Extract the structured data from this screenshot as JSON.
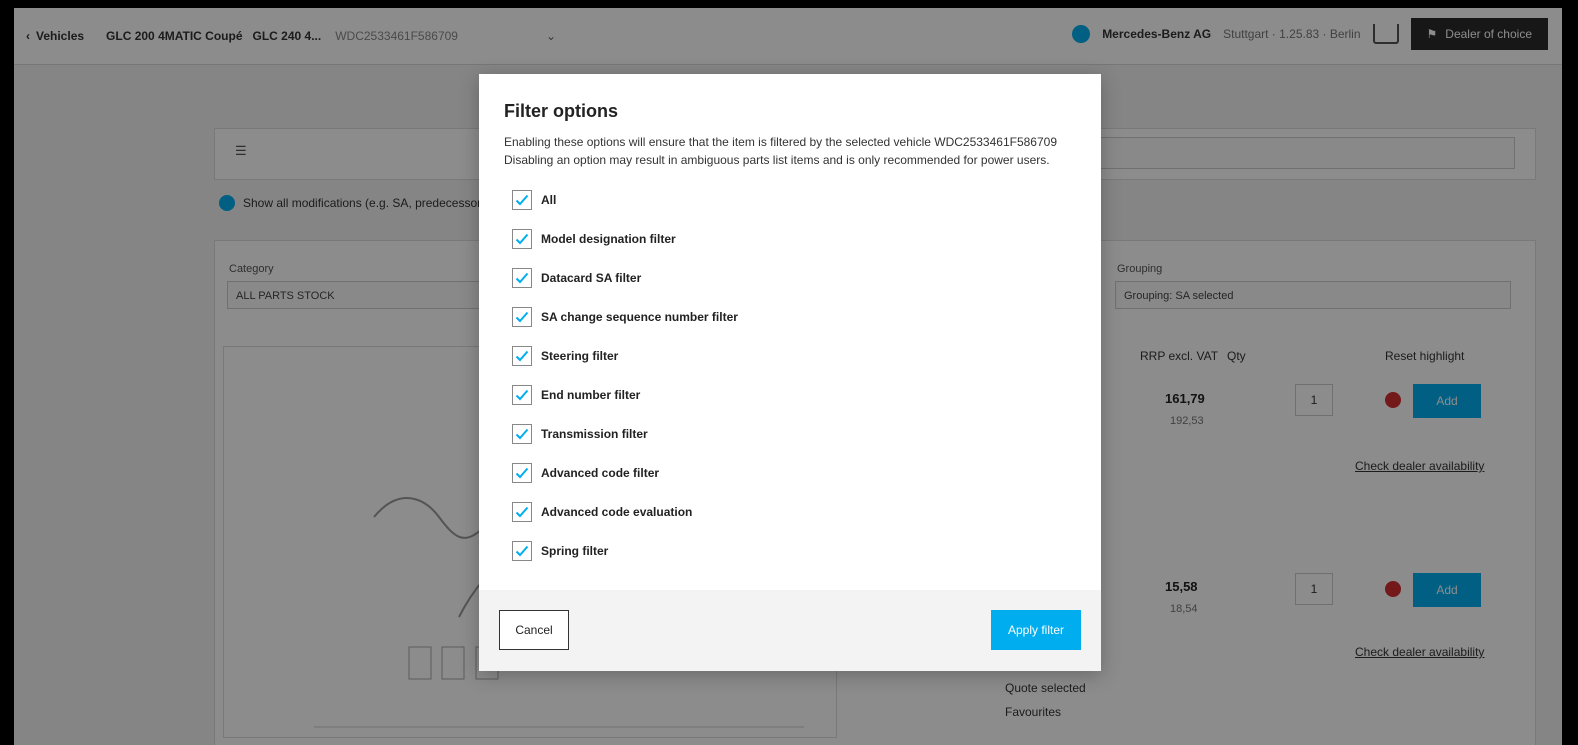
{
  "background": {
    "nav": {
      "back_label": "Vehicles",
      "vehicle_model": "GLC 200 4MATIC Coupé",
      "vehicle_engine": "GLC 240 4...",
      "vin": "WDC2533461F586709",
      "company": "Mercedes-Benz AG",
      "branch": "Stuttgart · 1.25.83 · Berlin",
      "dealer_button": "Dealer of choice"
    },
    "info_text": "Show all modifications (e.g. SA, predecessors, successors)",
    "category_label": "Category",
    "category_value": "ALL PARTS STOCK",
    "grouping_label": "Grouping",
    "grouping_value": "Grouping: SA selected",
    "col_price": "RRP excl. VAT",
    "col_qty": "Qty",
    "col_highlight": "Reset highlight",
    "rows": [
      {
        "price": "161,79",
        "subprice": "192,53",
        "qty": "1",
        "button": "Add",
        "link": "Check dealer availability"
      },
      {
        "price": "15,58",
        "subprice": "18,54",
        "qty": "1",
        "button": "Add",
        "link": "Check dealer availability"
      }
    ],
    "side_links": [
      "Quote selected",
      "Favourites"
    ]
  },
  "modal": {
    "title": "Filter options",
    "description_line1": "Enabling these options will ensure that the item is filtered by the selected vehicle WDC2533461F586709",
    "description_line2": "Disabling an option may result in ambiguous parts list items and is only recommended for power users.",
    "options": [
      {
        "label": "All",
        "checked": true
      },
      {
        "label": "Model designation filter",
        "checked": true
      },
      {
        "label": "Datacard SA filter",
        "checked": true
      },
      {
        "label": "SA change sequence number filter",
        "checked": true
      },
      {
        "label": "Steering filter",
        "checked": true
      },
      {
        "label": "End number filter",
        "checked": true
      },
      {
        "label": "Transmission filter",
        "checked": true
      },
      {
        "label": "Advanced code filter",
        "checked": true
      },
      {
        "label": "Advanced code evaluation",
        "checked": true
      },
      {
        "label": "Spring filter",
        "checked": true
      }
    ],
    "cancel_label": "Cancel",
    "apply_label": "Apply filter"
  },
  "colors": {
    "accent": "#00adef",
    "check": "#00adef",
    "overlay": "rgba(0,0,0,0.45)"
  }
}
